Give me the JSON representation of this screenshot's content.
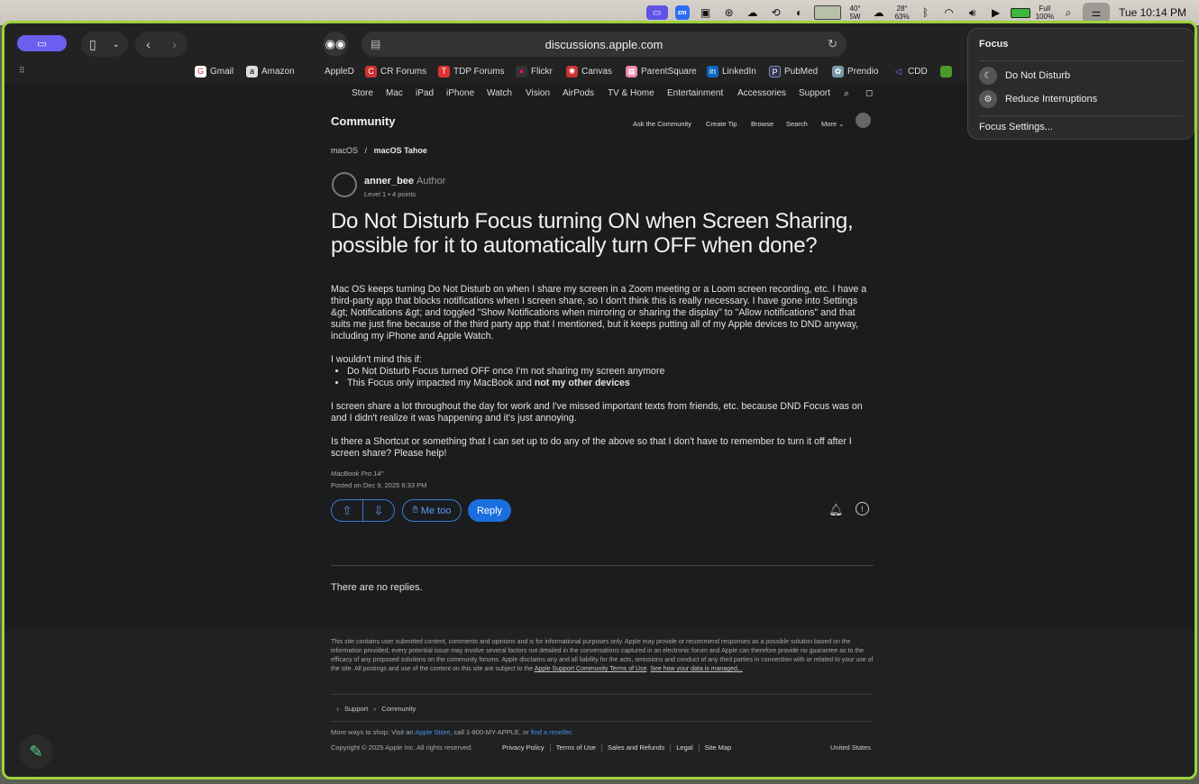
{
  "menubar": {
    "icons": [
      "screen-share-icon",
      "zoom-icon",
      "box-icon",
      "creative-cloud-icon",
      "icloud-icon",
      "time-machine-icon",
      "moon-icon",
      "battery-widget-icon",
      "weather-icon",
      "bluetooth-icon",
      "wifi-icon",
      "volume-icon",
      "play-icon",
      "battery-icon",
      "search-icon",
      "control-center-icon"
    ],
    "temp1_top": "40°",
    "temp1_bottom": "5W",
    "temp2_top": "28°",
    "temp2_bottom": "63%",
    "battery_top": "Full",
    "battery_bottom": "100%",
    "clock": "Tue 10:14 PM"
  },
  "browser": {
    "url": "discussions.apple.com",
    "bookmarks": [
      "Gmail",
      "Amazon",
      "AppleD",
      "CR Forums",
      "TDP Forums",
      "Flickr",
      "Canvas",
      "ParentSquare",
      "LinkedIn",
      "PubMed",
      "Prendio",
      "CDD"
    ]
  },
  "apple_nav": {
    "items": [
      "Store",
      "Mac",
      "iPad",
      "iPhone",
      "Watch",
      "Vision",
      "AirPods",
      "TV & Home",
      "Entertainment",
      "Accessories",
      "Support"
    ]
  },
  "community": {
    "title": "Community",
    "nav": [
      "Ask the Community",
      "Create Tip",
      "Browse",
      "Search",
      "More ⌄"
    ]
  },
  "breadcrumb": {
    "first": "macOS",
    "separator": "/",
    "second": "macOS Tahoe"
  },
  "post": {
    "author": "anner_bee",
    "author_tag": "Author",
    "author_meta": "Level 1  •  4 points",
    "title": "Do Not Disturb Focus turning ON when Screen Sharing, possible for it to automatically turn OFF when done?",
    "p1": "Mac OS keeps turning Do Not Disturb on when I share my screen in a Zoom meeting or a Loom screen recording, etc. I have a third-party app that blocks notifications when I screen share, so I don't think this is really necessary. I have gone into Settings &gt; Notifications &gt; and toggled \"Show Notifications when mirroring or sharing the display\" to \"Allow notifications\" and that suits me just fine because of the third party app that I mentioned, but it keeps putting all of my Apple devices to DND anyway, including my iPhone and Apple Watch.",
    "p2": "I wouldn't mind this if:",
    "bullet1": "Do Not Disturb Focus turned OFF once I'm not sharing my screen anymore",
    "bullet2_a": "This Focus only impacted my MacBook and ",
    "bullet2_b": "not my other devices",
    "p3": "I screen share a lot throughout the day for work and I've missed important texts from friends, etc. because DND Focus was on and I didn't realize it was happening and it's just annoying.",
    "p4": "Is there a Shortcut or something that I can set up to do any of the above so that I don't have to remember to turn it off after I screen share? Please help!",
    "device": "MacBook Pro 14\"",
    "posted": "Posted on Dec 9, 2025 6:33 PM",
    "metoo": "Me too",
    "reply": "Reply",
    "no_replies": "There are no replies."
  },
  "footer": {
    "disclaimer": "This site contains user submitted content, comments and opinions and is for informational purposes only. Apple may provide or recommend responses as a possible solution based on the information provided; every potential issue may involve several factors not detailed in the conversations captured in an electronic forum and Apple can therefore provide no guarantee as to the efficacy of any proposed solutions on the community forums. Apple disclaims any and all liability for the acts, omissions and conduct of any third parties in connection with or related to your use of the site. All postings and use of the content on this site are subject to the ",
    "terms_link": "Apple Support Community Terms of Use",
    "see_how": "See how your data is managed...",
    "crumb_support": "Support",
    "crumb_community": "Community",
    "ways_prefix": "More ways to shop: Visit an ",
    "apple_store": "Apple Store",
    "ways_mid": ", call 1-800-MY-APPLE, or ",
    "reseller": "find a reseller",
    "ways_end": ".",
    "copyright": "Copyright © 2025 Apple Inc. All rights reserved.",
    "links": [
      "Privacy Policy",
      "Terms of Use",
      "Sales and Refunds",
      "Legal",
      "Site Map"
    ],
    "country": "United States"
  },
  "focus_menu": {
    "title": "Focus",
    "item1": "Do Not Disturb",
    "item2": "Reduce Interruptions",
    "settings": "Focus Settings..."
  }
}
